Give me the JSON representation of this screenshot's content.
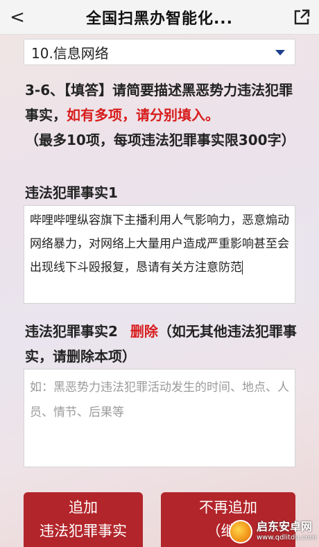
{
  "header": {
    "back_glyph": "<",
    "title": "全国扫黑办智能化...",
    "share_icon": "external-link-icon"
  },
  "dropdown": {
    "selected": "10.信息网络"
  },
  "question": {
    "prefix": "3-6、【填答】请简要描述黑恶势力违法犯罪事实，",
    "highlight": "如有多项，请分别填入。",
    "suffix": "（最多10项，每项违法犯罪事实限300字）"
  },
  "fact1": {
    "label": "违法犯罪事实1",
    "value": "哔哩哔哩纵容旗下主播利用人气影响力，恶意煽动网络暴力，对网络上大量用户造成严重影响甚至会出现线下斗殴报复，恳请有关方注意防范"
  },
  "fact2": {
    "label": "违法犯罪事实2",
    "delete_label": "删除",
    "note": "（如无其他违法犯罪事实，请删除本项）",
    "placeholder": "如：黑恶势力违法犯罪活动发生的时间、地点、人员、情节、后果等"
  },
  "buttons": {
    "add_line1": "追加",
    "add_line2": "违法犯罪事实",
    "stop_line1": "不再追加",
    "stop_line2": "（继续"
  },
  "watermark": {
    "name": "启东安卓网",
    "url": "www.qdlitdu.com"
  },
  "colors": {
    "accent_red": "#d81c1c",
    "button_red": "#b2252a",
    "dropdown_arrow": "#1b3f8c"
  }
}
